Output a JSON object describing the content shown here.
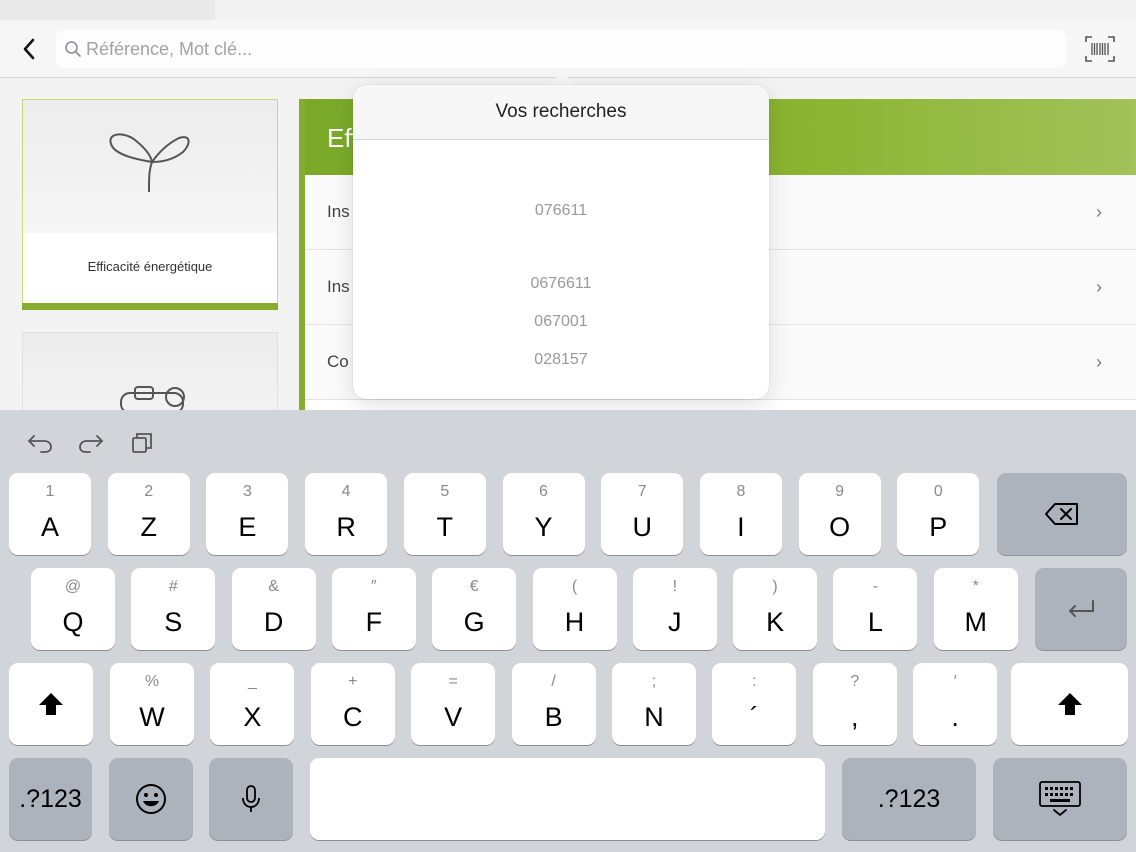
{
  "search": {
    "placeholder": "Référence, Mot clé...",
    "value": ""
  },
  "categories": [
    {
      "label": "Efficacité énergétique",
      "icon": "sprout-icon"
    },
    {
      "label": "",
      "icon": "plug-icon"
    }
  ],
  "panel": {
    "title": "Eff",
    "rows": [
      {
        "label": "Ins"
      },
      {
        "label": "Ins"
      },
      {
        "label": "Co"
      }
    ]
  },
  "popover": {
    "title": "Vos recherches",
    "items": [
      "076611",
      "0676611",
      "067001",
      "028157"
    ]
  },
  "keyboard": {
    "row1": [
      {
        "main": "A",
        "alt": "1"
      },
      {
        "main": "Z",
        "alt": "2"
      },
      {
        "main": "E",
        "alt": "3"
      },
      {
        "main": "R",
        "alt": "4"
      },
      {
        "main": "T",
        "alt": "5"
      },
      {
        "main": "Y",
        "alt": "6"
      },
      {
        "main": "U",
        "alt": "7"
      },
      {
        "main": "I",
        "alt": "8"
      },
      {
        "main": "O",
        "alt": "9"
      },
      {
        "main": "P",
        "alt": "0"
      }
    ],
    "row2": [
      {
        "main": "Q",
        "alt": "@"
      },
      {
        "main": "S",
        "alt": "#"
      },
      {
        "main": "D",
        "alt": "&"
      },
      {
        "main": "F",
        "alt": "″"
      },
      {
        "main": "G",
        "alt": "€"
      },
      {
        "main": "H",
        "alt": "("
      },
      {
        "main": "J",
        "alt": "!"
      },
      {
        "main": "K",
        "alt": ")"
      },
      {
        "main": "L",
        "alt": "-"
      },
      {
        "main": "M",
        "alt": "*"
      }
    ],
    "row3": [
      {
        "main": "W",
        "alt": "%"
      },
      {
        "main": "X",
        "alt": "_"
      },
      {
        "main": "C",
        "alt": "+"
      },
      {
        "main": "V",
        "alt": "="
      },
      {
        "main": "B",
        "alt": "/"
      },
      {
        "main": "N",
        "alt": ";"
      },
      {
        "main": "´",
        "alt": ":"
      },
      {
        "main": ",",
        "alt": "?"
      },
      {
        "main": ".",
        "alt": "′"
      }
    ],
    "numbers_label": ".?123",
    "colors": {
      "key": "#ffffff",
      "dark_key": "#adb3bc",
      "background": "#d1d4d9",
      "accent": "#86ae2c"
    }
  }
}
